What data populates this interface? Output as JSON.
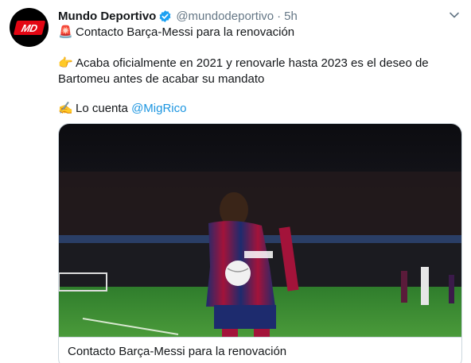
{
  "account": {
    "avatar_text": "MD",
    "name": "Mundo Deportivo",
    "handle": "@mundodeportivo",
    "separator": "·",
    "time": "5h",
    "verified": true
  },
  "icons": {
    "verified": "verified-badge-icon",
    "caret": "chevron-down-icon",
    "siren": "🚨",
    "pointing_hand": "👉",
    "writing_hand": "✍️"
  },
  "tweet": {
    "line1": "Contacto Barça-Messi para la renovación",
    "para2": "Acaba oficialmente en 2021 y renovarle hasta 2023 es el deseo de Bartomeu antes de acabar su mandato",
    "para3_prefix": "Lo cuenta",
    "mention": "@MigRico"
  },
  "card": {
    "title": "Contacto Barça-Messi para la renovación"
  },
  "colors": {
    "link": "#1b95e0",
    "verified": "#1da1f2",
    "brand_red": "#e30613",
    "secondary_text": "#657786"
  }
}
